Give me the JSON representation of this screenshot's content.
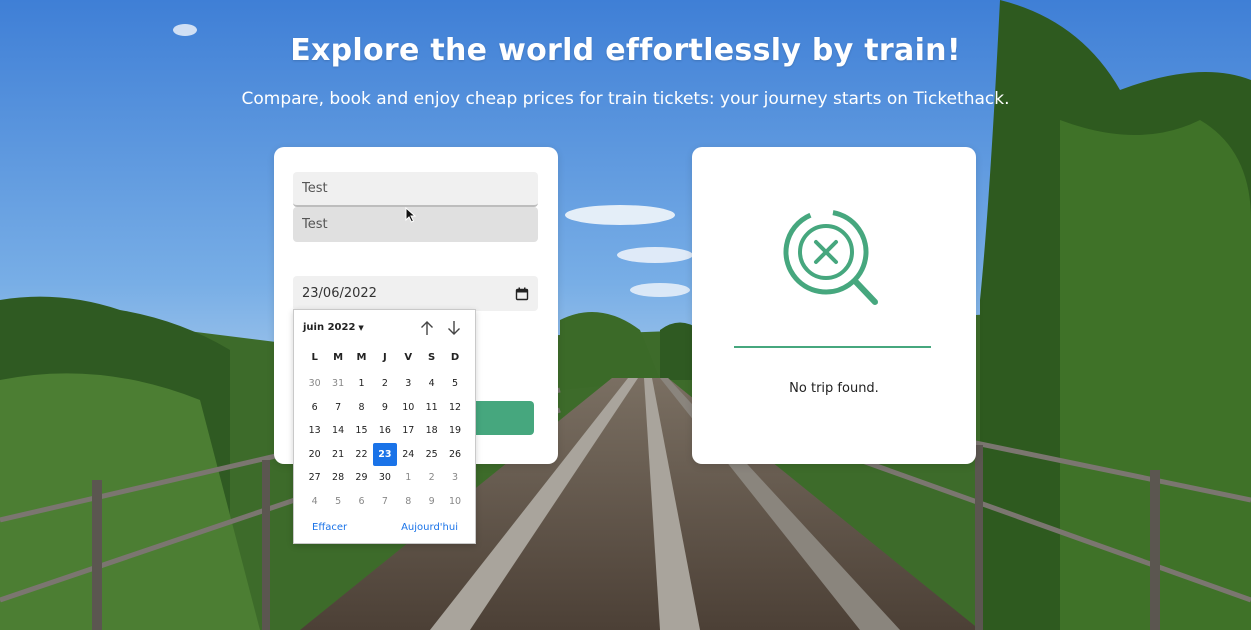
{
  "hero": {
    "title": "Explore the world effortlessly by train!",
    "subtitle": "Compare, book and enjoy cheap prices for train tickets: your journey starts on Tickethack."
  },
  "search": {
    "departure_value": "Test",
    "arrival_value": "Test",
    "date_value": "23/06/2022",
    "date_icon": "calendar-icon",
    "button_color": "#46a77e"
  },
  "calendar": {
    "month_label": "juin 2022",
    "weekdays": [
      "L",
      "M",
      "M",
      "J",
      "V",
      "S",
      "D"
    ],
    "weeks": [
      [
        "30",
        "31",
        "1",
        "2",
        "3",
        "4",
        "5"
      ],
      [
        "6",
        "7",
        "8",
        "9",
        "10",
        "11",
        "12"
      ],
      [
        "13",
        "14",
        "15",
        "16",
        "17",
        "18",
        "19"
      ],
      [
        "20",
        "21",
        "22",
        "23",
        "24",
        "25",
        "26"
      ],
      [
        "27",
        "28",
        "29",
        "30",
        "1",
        "2",
        "3"
      ],
      [
        "4",
        "5",
        "6",
        "7",
        "8",
        "9",
        "10"
      ]
    ],
    "selected_day": "23",
    "clear_label": "Effacer",
    "today_label": "Aujourd'hui"
  },
  "results": {
    "icon": "search-no-result-icon",
    "message": "No trip found.",
    "accent_color": "#46a77e"
  }
}
